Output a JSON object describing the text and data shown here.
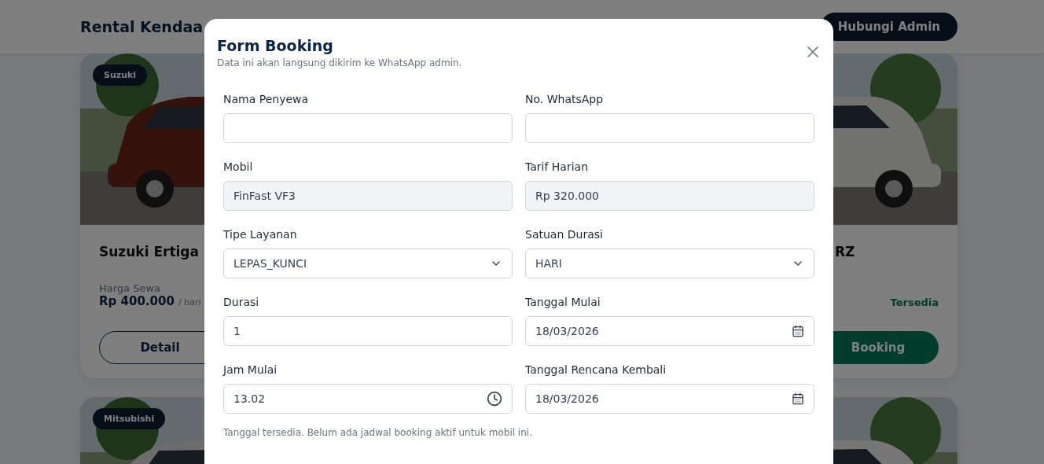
{
  "header": {
    "title": "Rental Kendaa",
    "button": "Hubungi Admin"
  },
  "cards": [
    {
      "kind": "car",
      "badge": "Suzuki",
      "name": "Suzuki Ertiga",
      "price_label": "Harga Sewa",
      "price": "Rp 400.000",
      "unit": "/ hari",
      "buttons": [
        {
          "label": "Detail",
          "kind": "outline"
        }
      ]
    },
    {
      "kind": "car",
      "name": "RZ",
      "status": "Tersedia",
      "buttons": [
        {
          "label": "Booking",
          "kind": "solid"
        }
      ]
    },
    {
      "kind": "picture",
      "badge": "Mitsubishi"
    },
    {
      "kind": "picture"
    }
  ],
  "modal": {
    "title": "Form Booking",
    "subtitle": "Data ini akan langsung dikirim ke WhatsApp admin.",
    "fields": [
      {
        "label": "Nama Penyewa",
        "kind": "text",
        "disabled": false
      },
      {
        "label": "No. WhatsApp",
        "kind": "text",
        "disabled": false
      },
      {
        "label": "Mobil",
        "kind": "text",
        "value": "FinFast VF3",
        "disabled": true
      },
      {
        "label": "Tarif Harian",
        "kind": "text",
        "value": "Rp 320.000",
        "disabled": true
      },
      {
        "label": "Tipe Layanan",
        "kind": "select",
        "value": "LEPAS_KUNCI",
        "disabled": false
      },
      {
        "label": "Satuan Durasi",
        "kind": "select",
        "value": "HARI",
        "disabled": false
      },
      {
        "label": "Durasi",
        "kind": "text",
        "value": "1",
        "disabled": false
      },
      {
        "label": "Tanggal Mulai",
        "kind": "date",
        "value": "18/03/2026",
        "disabled": false
      },
      {
        "label": "Jam Mulai",
        "kind": "time",
        "value": "13.02",
        "disabled": false
      },
      {
        "label": "Tanggal Rencana Kembali",
        "kind": "date",
        "value": "18/03/2026",
        "disabled": false
      }
    ],
    "note": "Tanggal tersedia. Belum ada jadwal booking aktif untuk mobil ini."
  }
}
